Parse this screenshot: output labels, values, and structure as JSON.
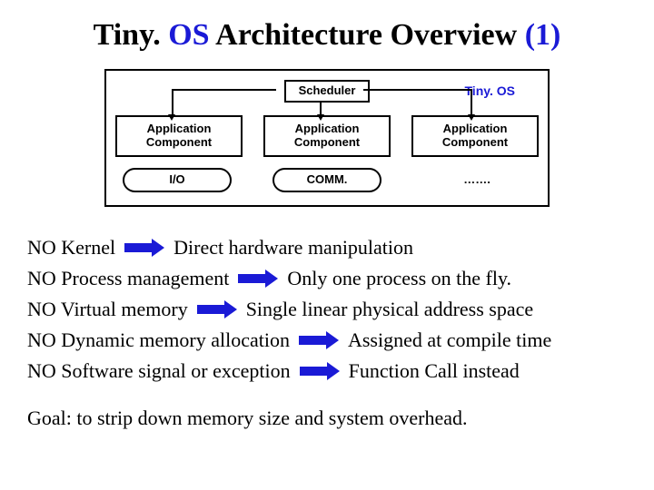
{
  "title": {
    "prefix": "Tiny. ",
    "highlight_word": "OS",
    "middle": " Architecture Overview ",
    "suffix_highlight": "(1)"
  },
  "diagram": {
    "tinyos_label": "Tiny. OS",
    "scheduler": "Scheduler",
    "apps": [
      "Application Component",
      "Application Component",
      "Application Component"
    ],
    "bottom": [
      "I/O",
      "COMM.",
      "……."
    ]
  },
  "bullets": [
    {
      "left": "NO Kernel",
      "right": "Direct hardware manipulation"
    },
    {
      "left": "NO Process management",
      "right": "Only one process on the fly."
    },
    {
      "left": "NO Virtual memory",
      "right": "Single linear physical address space"
    },
    {
      "left": "NO Dynamic memory allocation",
      "right": "Assigned at compile time"
    },
    {
      "left": "NO Software signal or exception",
      "right": "Function Call instead"
    }
  ],
  "goal": "Goal: to strip down memory size and system overhead."
}
